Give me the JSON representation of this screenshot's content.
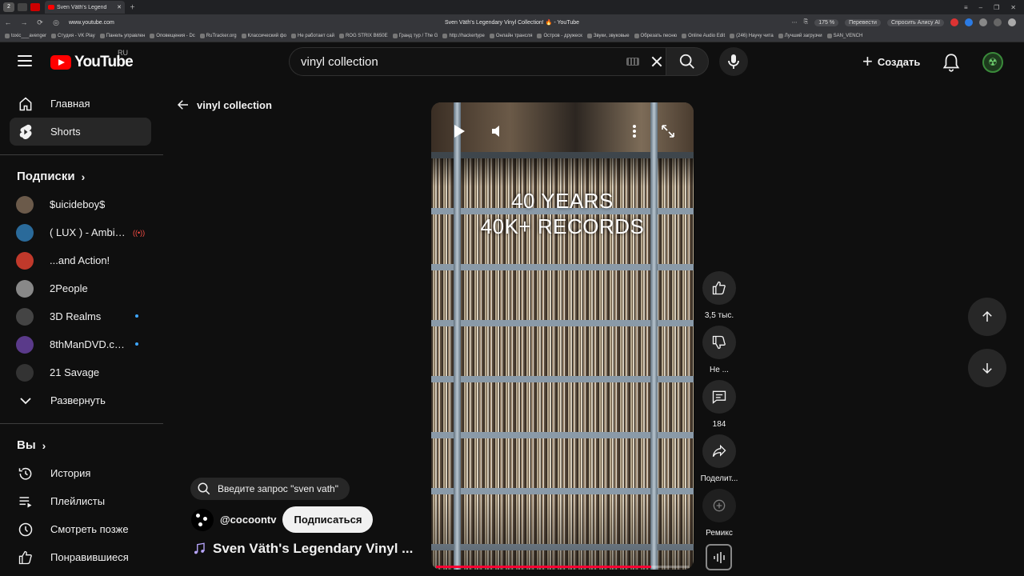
{
  "browser": {
    "tab_count": "2",
    "tab_title": "Sven Väth's Legend",
    "url": "www.youtube.com",
    "page_title": "Sven Väth's Legendary Vinyl Collection! 🔥 - YouTube",
    "zoom": "175 %",
    "translate": "Перевести",
    "alice": "Спросить Алису AI",
    "bookmarks": [
      "toxic___avenger",
      "Студия - VK Play",
      "Панель управлен",
      "Оповещения - Dc",
      "RuTracker.org",
      "Классический фо",
      "Не работает сай",
      "ROG STRIX B650E",
      "Гранд тур / The G",
      "http://hackertype",
      "Онлайн трансля",
      "Остров - дружеск",
      "Звуки, звуковые",
      "Обрезать песню",
      "Online Audio Edit",
      "(246) Научу чита",
      "Лучший загрузчи",
      "SAN_VENCH"
    ]
  },
  "header": {
    "logo_text": "YouTube",
    "region": "RU",
    "search_value": "vinyl collection",
    "create_label": "Создать"
  },
  "sidebar": {
    "main": [
      {
        "label": "Главная",
        "icon": "home-icon"
      },
      {
        "label": "Shorts",
        "icon": "shorts-icon"
      }
    ],
    "subs_title": "Подписки",
    "subs": [
      {
        "label": "$uicideboy$",
        "color": "#6b5a4a"
      },
      {
        "label": "( LUX ) - Ambient...",
        "color": "#2a6a9a"
      },
      {
        "label": "...and Action!",
        "color": "#c0392b"
      },
      {
        "label": "2People",
        "color": "#888888"
      },
      {
        "label": "3D Realms",
        "color": "#444444"
      },
      {
        "label": "8thManDVD.com...",
        "color": "#5a3a8a"
      },
      {
        "label": "21 Savage",
        "color": "#333333"
      }
    ],
    "expand_label": "Развернуть",
    "you_title": "Вы",
    "you": [
      {
        "label": "История",
        "icon": "history-icon"
      },
      {
        "label": "Плейлисты",
        "icon": "playlists-icon"
      },
      {
        "label": "Смотреть позже",
        "icon": "watch-later-icon"
      },
      {
        "label": "Понравившиеся",
        "icon": "liked-icon"
      }
    ]
  },
  "main": {
    "back_label": "vinyl collection",
    "overlay_line1": "40 YEARS",
    "overlay_line2": "40K+ RECORDS",
    "progress_fraction": 0.85,
    "likes": "3,5 тыс.",
    "dislike": "Не ...",
    "comments": "184",
    "share": "Поделит...",
    "remix": "Ремикс",
    "suggest_query": "Введите запрос \"sven vath\"",
    "channel_handle": "@cocoontv",
    "subscribe_label": "Подписаться",
    "video_title": "Sven Väth's Legendary Vinyl ..."
  },
  "colors": {
    "accent_red": "#ff0000",
    "background": "#0f0f0f",
    "chip": "#272727"
  }
}
